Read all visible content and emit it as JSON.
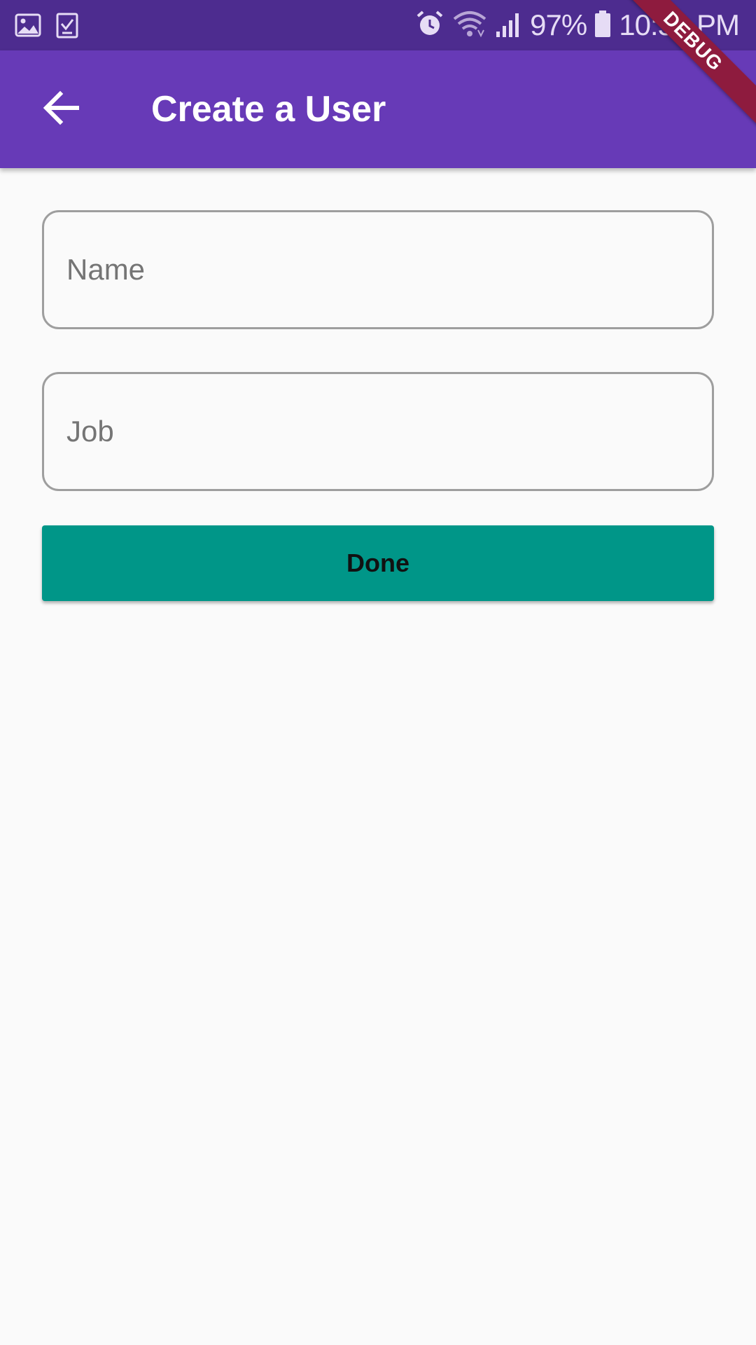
{
  "status_bar": {
    "left_icons": [
      "image-icon",
      "clipboard-check-icon"
    ],
    "right_icons": [
      "alarm-icon",
      "wifi-icon",
      "signal-icon"
    ],
    "battery": "97%",
    "time": "10:53 PM"
  },
  "app_bar": {
    "title": "Create a User",
    "back_icon": "arrow-back-icon",
    "debug_label": "DEBUG"
  },
  "form": {
    "name_placeholder": "Name",
    "name_value": "",
    "job_placeholder": "Job",
    "job_value": "",
    "done_label": "Done"
  },
  "colors": {
    "status_bar": "#4d2c8f",
    "app_bar": "#673ab7",
    "button": "#009688",
    "debug_banner": "#8e1b3e",
    "background": "#fafafa"
  }
}
